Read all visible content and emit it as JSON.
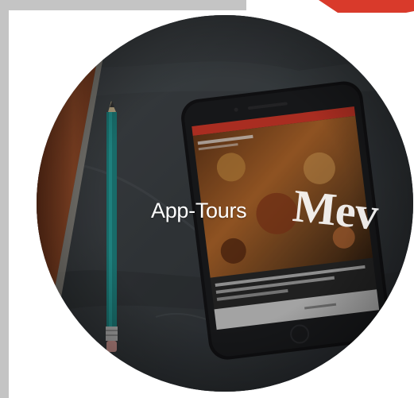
{
  "card": {
    "title": "App-Tours"
  },
  "phone_screen": {
    "headline": "Mev"
  },
  "colors": {
    "page_background": "#ffffff",
    "gray_frame": "#c4c4c4",
    "accent_red": "#d93a2b",
    "title_text": "#ffffff"
  },
  "icons": [
    "pencil-icon",
    "phone-icon"
  ]
}
